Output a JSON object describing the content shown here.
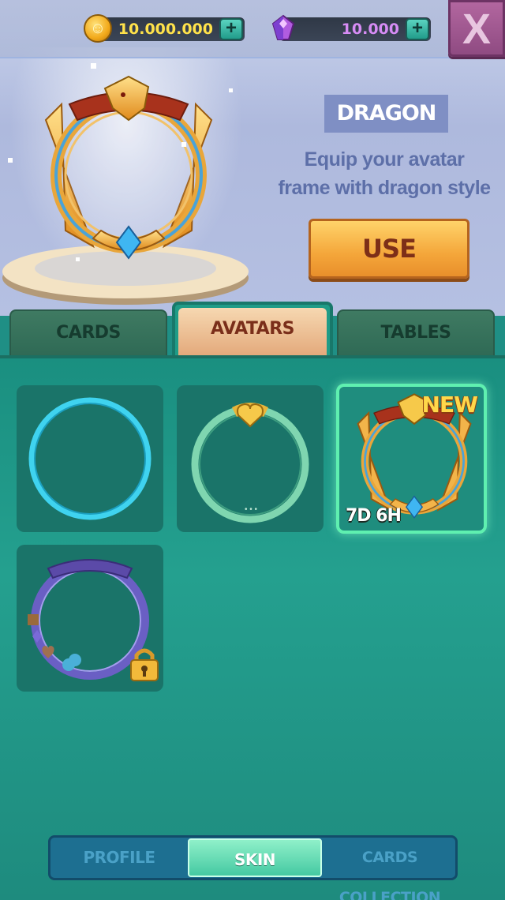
{
  "header": {
    "coins": {
      "value": "10.000.000",
      "add_label": "+",
      "color": "#ffe24a"
    },
    "gems": {
      "value": "10.000",
      "add_label": "+",
      "color": "#d78cf5"
    },
    "close_label": "X"
  },
  "preview": {
    "title": "DRAGON",
    "description": "Equip your avatar frame with dragon style",
    "use_button": "USE"
  },
  "category_tabs": [
    {
      "label": "CARDS",
      "active": false
    },
    {
      "label": "AVATARS",
      "active": true
    },
    {
      "label": "TABLES",
      "active": false
    }
  ],
  "avatar_frames": [
    {
      "name": "cyan-ring",
      "state": "owned"
    },
    {
      "name": "heart-ring",
      "state": "owned"
    },
    {
      "name": "dragon-ring",
      "state": "selected",
      "badge": "NEW",
      "timer": "7D 6H"
    },
    {
      "name": "suits-ring",
      "state": "locked"
    }
  ],
  "bottom_nav": [
    {
      "label": "PROFILE",
      "active": false
    },
    {
      "label": "SKIN",
      "active": true
    },
    {
      "label": "CARDS COLLECTION",
      "active": false
    }
  ],
  "colors": {
    "accent_teal": "#1f9c87",
    "use_orange": "#f4a63a",
    "selected_glow": "#5ff0b0"
  }
}
